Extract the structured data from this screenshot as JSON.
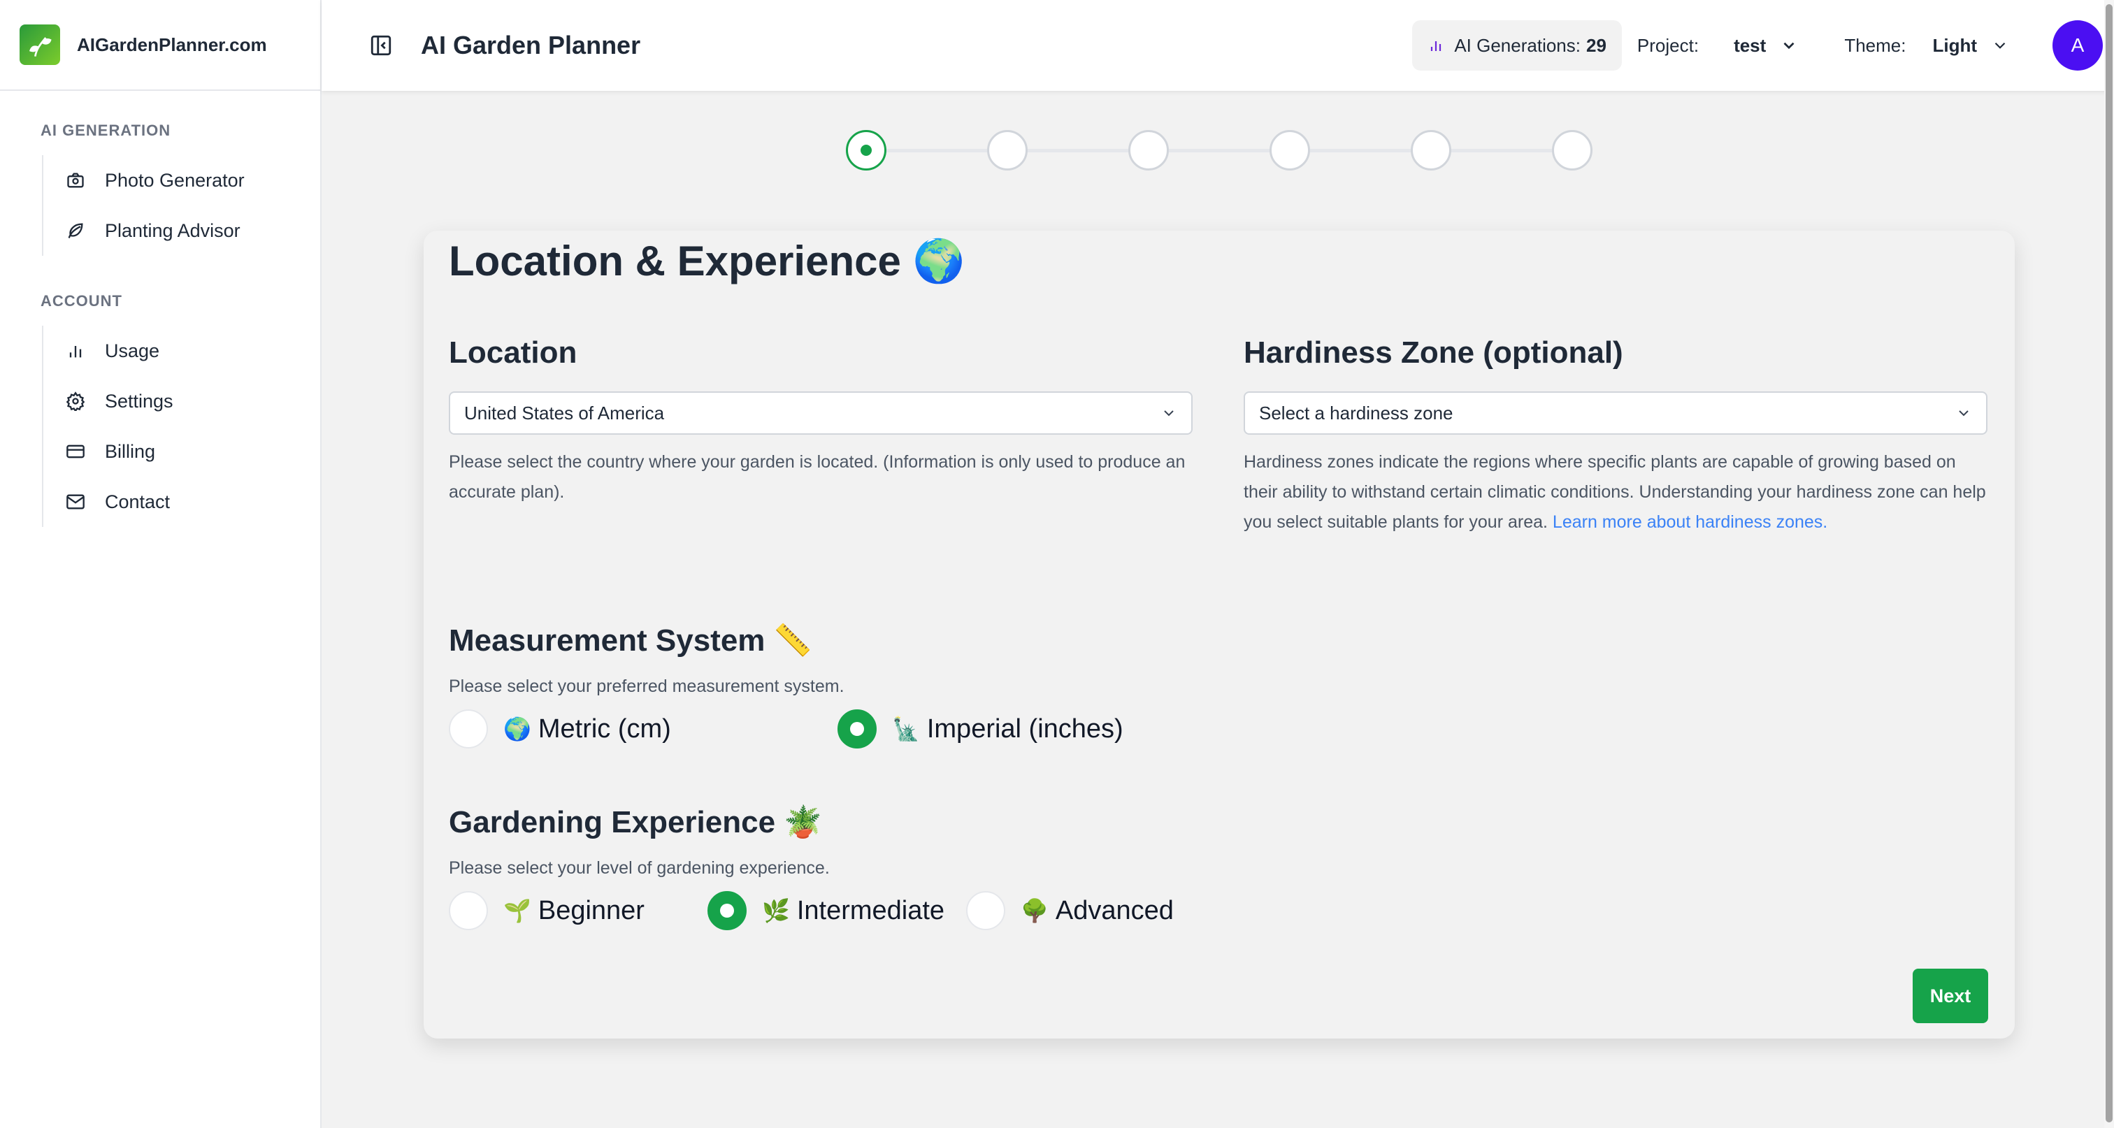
{
  "brand": {
    "name": "AIGardenPlanner.com"
  },
  "sidebar": {
    "sections": [
      {
        "title": "AI GENERATION",
        "items": [
          {
            "label": "Photo Generator",
            "icon": "camera-icon"
          },
          {
            "label": "Planting Advisor",
            "icon": "leaf-icon"
          }
        ]
      },
      {
        "title": "ACCOUNT",
        "items": [
          {
            "label": "Usage",
            "icon": "bar-chart-icon"
          },
          {
            "label": "Settings",
            "icon": "gear-icon"
          },
          {
            "label": "Billing",
            "icon": "credit-card-icon"
          },
          {
            "label": "Contact",
            "icon": "mail-icon"
          }
        ]
      }
    ]
  },
  "header": {
    "title": "AI Garden Planner",
    "generations_label": "AI Generations:",
    "generations_count": "29",
    "project_label": "Project:",
    "project_value": "test",
    "theme_label": "Theme:",
    "theme_value": "Light",
    "avatar_initial": "A"
  },
  "stepper": {
    "total_steps": 6,
    "current_step": 1
  },
  "card": {
    "title": "Location & Experience",
    "title_emoji": "🌍",
    "location": {
      "title": "Location",
      "value": "United States of America",
      "help": "Please select the country where your garden is located. (Information is only used to produce an accurate plan)."
    },
    "hardiness": {
      "title": "Hardiness Zone (optional)",
      "placeholder": "Select a hardiness zone",
      "help": "Hardiness zones indicate the regions where specific plants are capable of growing based on their ability to withstand certain climatic conditions. Understanding your hardiness zone can help you select suitable plants for your area.",
      "link": "Learn more about hardiness zones."
    },
    "measurement": {
      "title": "Measurement System",
      "title_emoji": "📏",
      "help": "Please select your preferred measurement system.",
      "options": [
        {
          "emoji": "🌍",
          "label": "Metric (cm)",
          "selected": false
        },
        {
          "emoji": "🗽",
          "label": "Imperial (inches)",
          "selected": true
        }
      ]
    },
    "experience": {
      "title": "Gardening Experience",
      "title_emoji": "🪴",
      "help": "Please select your level of gardening experience.",
      "options": [
        {
          "emoji": "🌱",
          "label": "Beginner",
          "selected": false
        },
        {
          "emoji": "🌿",
          "label": "Intermediate",
          "selected": true
        },
        {
          "emoji": "🌳",
          "label": "Advanced",
          "selected": false
        }
      ]
    },
    "next_label": "Next"
  },
  "colors": {
    "accent": "#16a34a",
    "avatar": "#4b0ff2",
    "link": "#3b82f6"
  }
}
